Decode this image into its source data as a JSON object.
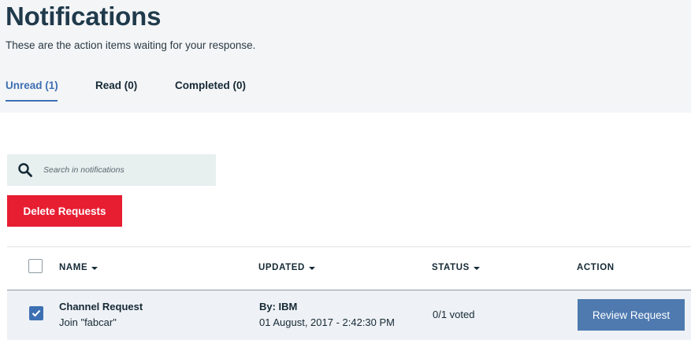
{
  "page": {
    "title": "Notifications",
    "subtitle": "These are the action items waiting for your response."
  },
  "tabs": [
    {
      "label": "Unread (1)",
      "active": true
    },
    {
      "label": "Read (0)",
      "active": false
    },
    {
      "label": "Completed (0)",
      "active": false
    }
  ],
  "search": {
    "placeholder": "Search in notifications",
    "value": "",
    "icon": "search-icon"
  },
  "toolbar": {
    "delete_label": "Delete Requests"
  },
  "table": {
    "columns": [
      {
        "label": "NAME",
        "sortable": true
      },
      {
        "label": "UPDATED",
        "sortable": true
      },
      {
        "label": "STATUS",
        "sortable": true
      },
      {
        "label": "ACTION",
        "sortable": false
      }
    ],
    "select_all_checked": false,
    "rows": [
      {
        "checked": true,
        "name": "Channel Request",
        "description": "Join \"fabcar\"",
        "updated_by": "By: IBM",
        "updated_at": "01 August, 2017 - 2:42:30 PM",
        "status": "0/1 voted",
        "action_label": "Review Request"
      }
    ]
  },
  "colors": {
    "accent": "#3d70b2",
    "danger": "#e71d32",
    "action_button": "#4e7ab0",
    "header_bg": "#f4f5f7",
    "row_bg": "#eef1f5",
    "search_bg": "#e7efef"
  }
}
